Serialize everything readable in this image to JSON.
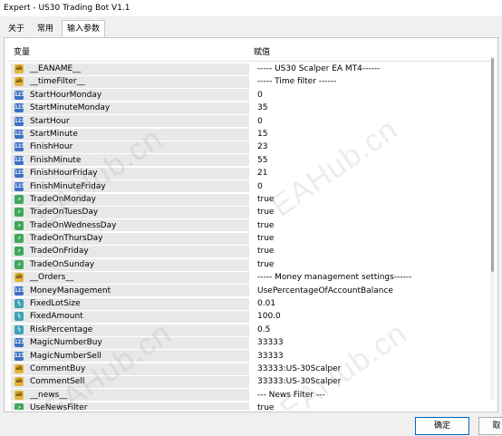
{
  "window": {
    "title": "Expert - US30 Trading Bot V1.1"
  },
  "tabs": [
    {
      "label": "关于"
    },
    {
      "label": "常用"
    },
    {
      "label": "输入参数"
    }
  ],
  "table": {
    "columns": [
      "变量",
      "赋值"
    ],
    "rows": [
      {
        "icon": "ab",
        "name": "__EANAME__",
        "value": "----- US30 Scalper EA MT4------"
      },
      {
        "icon": "ab",
        "name": "__timeFilter__",
        "value": "----- Time filter ------"
      },
      {
        "icon": "num",
        "name": "StartHourMonday",
        "value": "0"
      },
      {
        "icon": "num",
        "name": "StartMinuteMonday",
        "value": "35"
      },
      {
        "icon": "num",
        "name": "StartHour",
        "value": "0"
      },
      {
        "icon": "num",
        "name": "StartMinute",
        "value": "15"
      },
      {
        "icon": "num",
        "name": "FinishHour",
        "value": "23"
      },
      {
        "icon": "num",
        "name": "FinishMinute",
        "value": "55"
      },
      {
        "icon": "num",
        "name": "FinishHourFriday",
        "value": "21"
      },
      {
        "icon": "num",
        "name": "FinishMinuteFriday",
        "value": "0"
      },
      {
        "icon": "bool",
        "name": "TradeOnMonday",
        "value": "true"
      },
      {
        "icon": "bool",
        "name": "TradeOnTuesDay",
        "value": "true"
      },
      {
        "icon": "bool",
        "name": "TradeOnWednessDay",
        "value": "true"
      },
      {
        "icon": "bool",
        "name": "TradeOnThursDay",
        "value": "true"
      },
      {
        "icon": "bool",
        "name": "TradeOnFriday",
        "value": "true"
      },
      {
        "icon": "bool",
        "name": "TradeOnSunday",
        "value": "true"
      },
      {
        "icon": "ab",
        "name": "__Orders__",
        "value": "----- Money management settings------"
      },
      {
        "icon": "num",
        "name": "MoneyManagement",
        "value": "UsePercentageOfAccountBalance"
      },
      {
        "icon": "dbl",
        "name": "FixedLotSize",
        "value": "0.01"
      },
      {
        "icon": "dbl",
        "name": "FixedAmount",
        "value": "100.0"
      },
      {
        "icon": "dbl",
        "name": "RiskPercentage",
        "value": "0.5"
      },
      {
        "icon": "num",
        "name": "MagicNumberBuy",
        "value": "33333"
      },
      {
        "icon": "num",
        "name": "MagicNumberSell",
        "value": "33333"
      },
      {
        "icon": "ab",
        "name": "CommentBuy",
        "value": "33333:US-30Scalper"
      },
      {
        "icon": "ab",
        "name": "CommentSell",
        "value": "33333:US-30Scalper"
      },
      {
        "icon": "ab",
        "name": "__news__",
        "value": "--- News Filter ---"
      },
      {
        "icon": "bool",
        "name": "UseNewsFilter",
        "value": "true"
      }
    ]
  },
  "icon_glyphs": {
    "ab": "ab",
    "num": "123",
    "bool": "↗",
    "dbl": "½"
  },
  "watermark": {
    "text": "EAHub.cn"
  },
  "buttons": {
    "ok": "确定",
    "cancel": "取"
  },
  "colors": {
    "name_cell_bg": "#e8e8e8",
    "accent": "#0067c0"
  }
}
